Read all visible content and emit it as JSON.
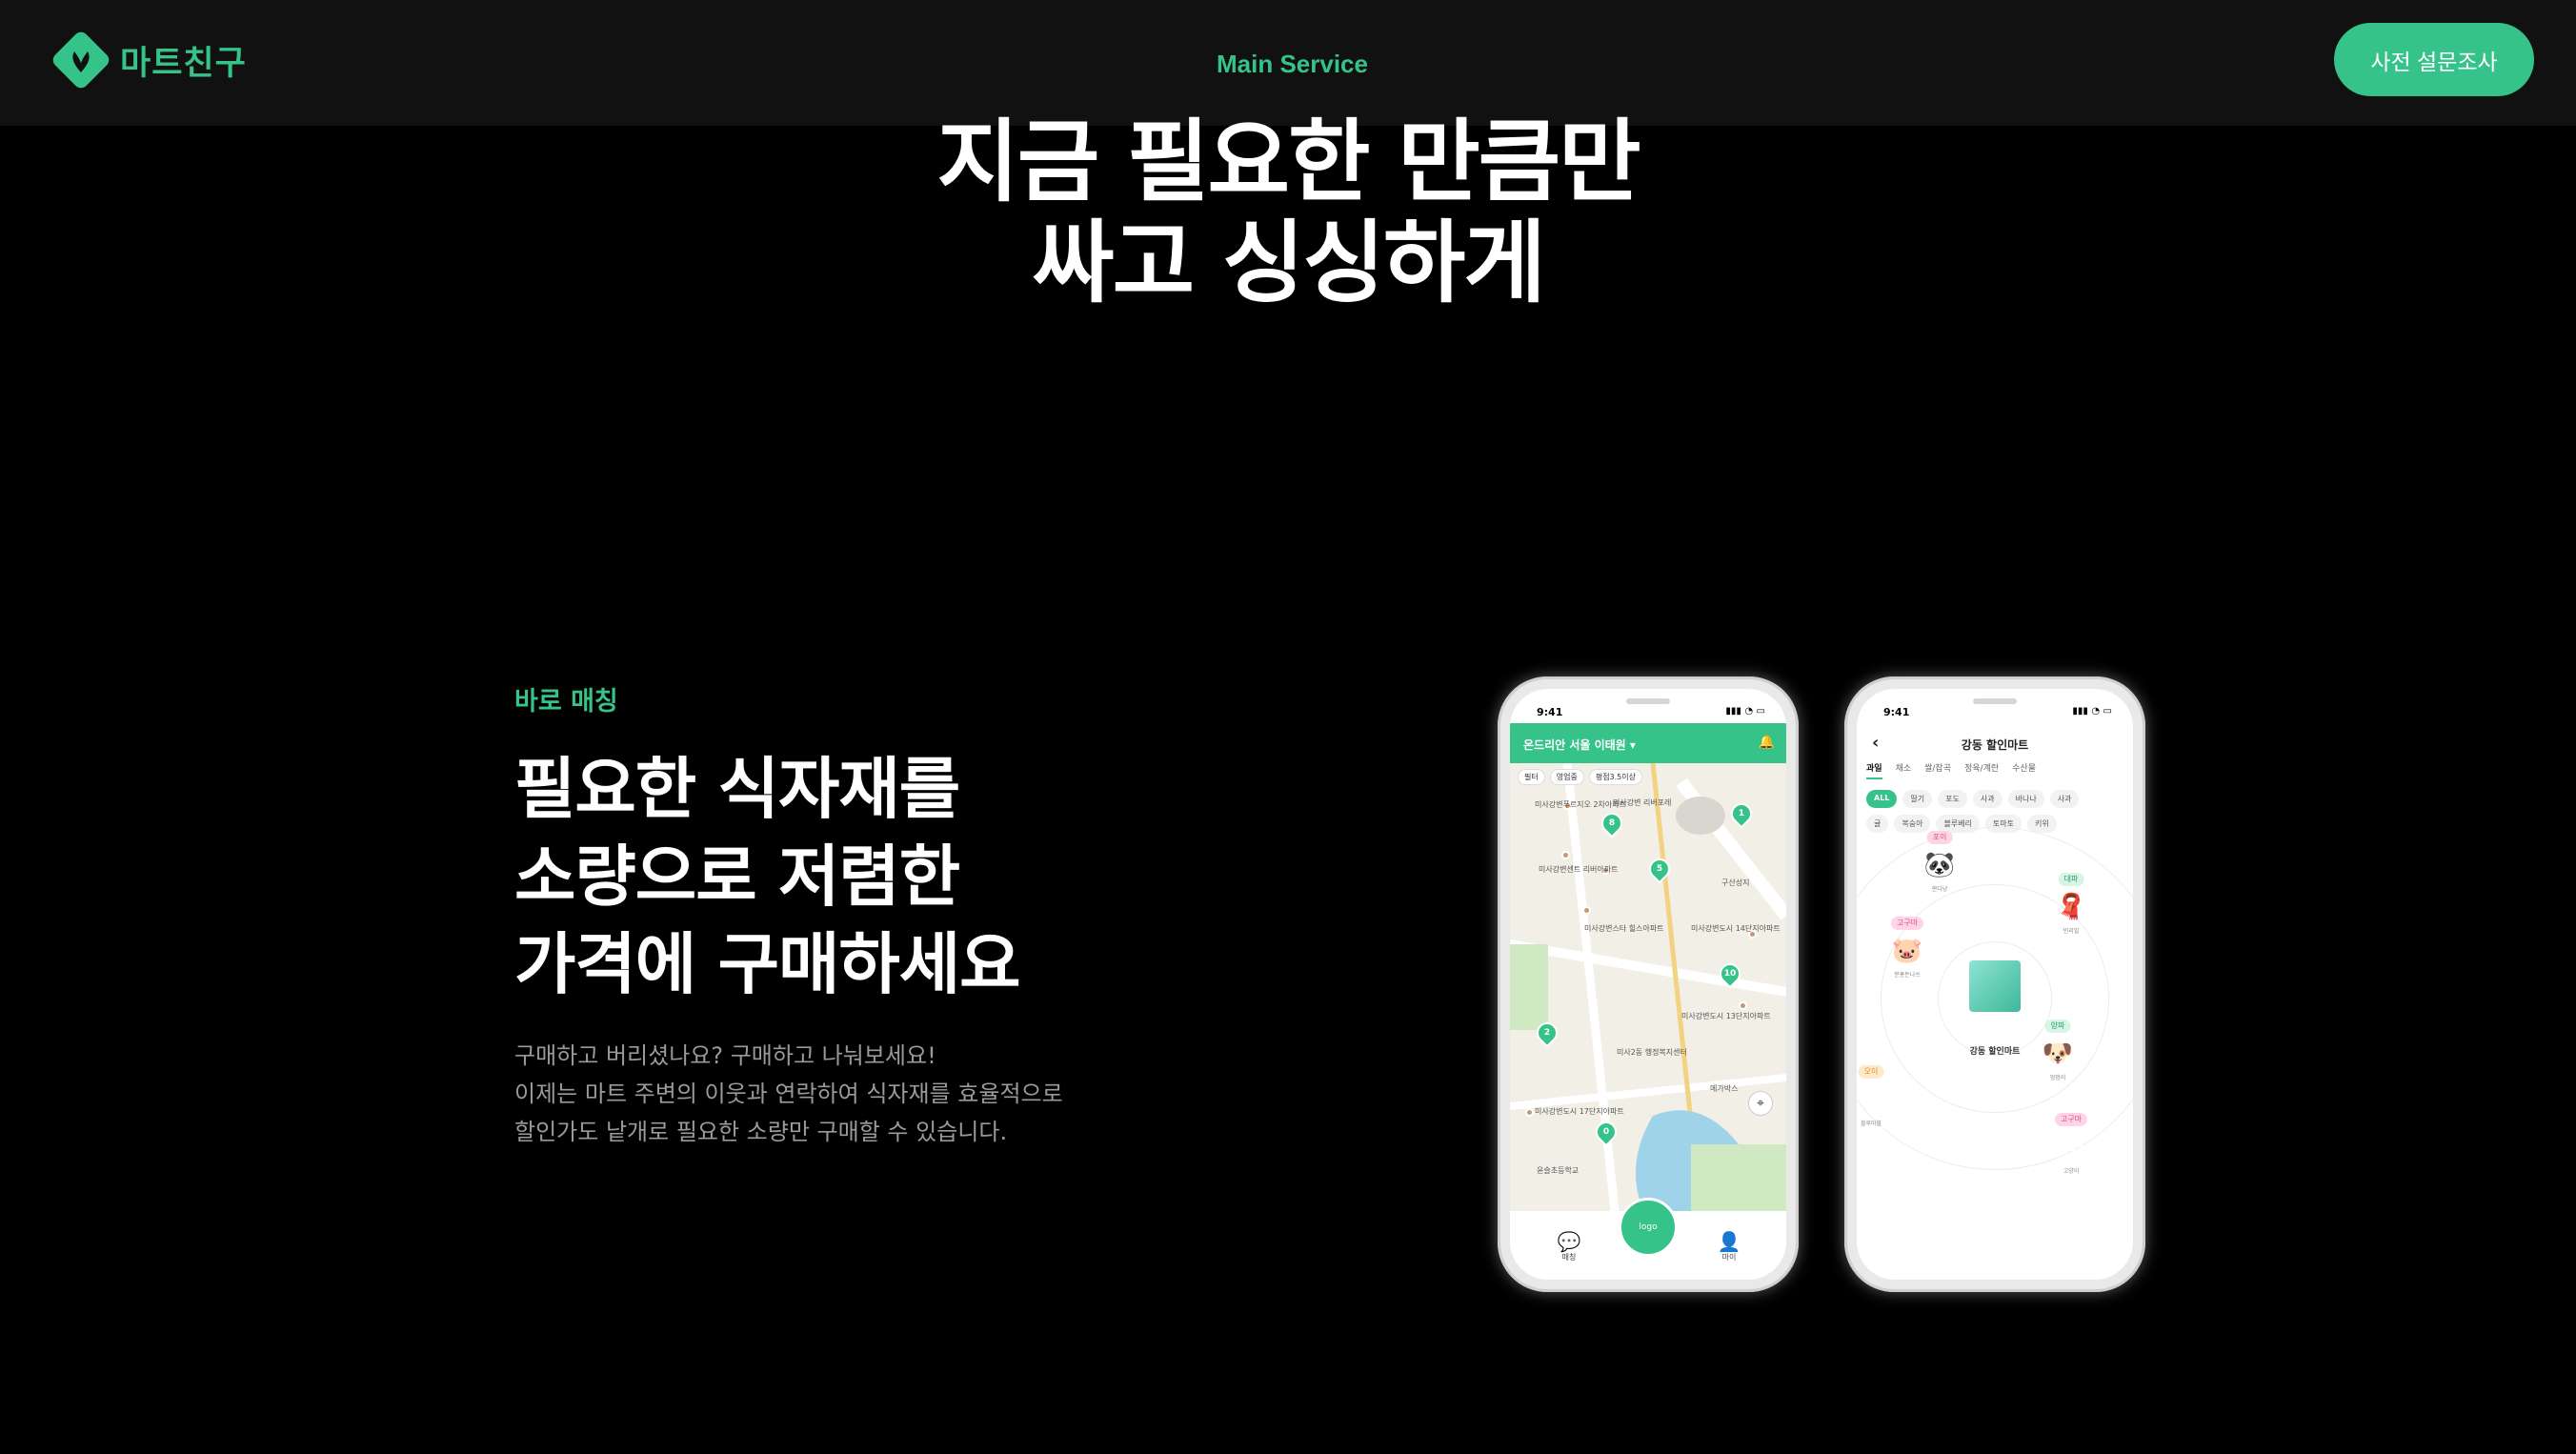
{
  "nav": {
    "logo_text": "마트친구",
    "main_link": "Main Service",
    "cta_button": "사전 설문조사",
    "accent_color": "#36c389"
  },
  "hero": {
    "line1": "지금 필요한 만큼만",
    "line2": "싸고 싱싱하게"
  },
  "feature": {
    "eyebrow": "바로 매칭",
    "title_lines": [
      "필요한 식자재를",
      "소량으로 저렴한",
      "가격에 구매하세요"
    ],
    "desc_lines": [
      "구매하고 버리셨나요? 구매하고 나눠보세요!",
      "이제는 마트 주변의 이웃과 연락하여 식자재를 효율적으로",
      "할인가도 낱개로 필요한 소량만 구매할 수 있습니다."
    ]
  },
  "phone_map": {
    "time": "9:41",
    "location": "온드리안 서울 이태원 ▾",
    "chips": [
      "필터",
      "영업중",
      "평점3.5이상"
    ],
    "pins": [
      "8",
      "5",
      "1",
      "10",
      "2",
      "0"
    ],
    "pois": [
      "미사강변푸르지오 2차아파트",
      "미사강변 리버포레",
      "미사강변센트 리버아파트",
      "미사강변스타 힐스아파트",
      "미사강변도시 14단지아파트",
      "미사강변도시 13단지아파트",
      "미사2동 행정복지센터",
      "메가박스",
      "미사강변도시 17단지아파트",
      "윤슬초등학교",
      "구산성지"
    ],
    "tabs": [
      "매칭",
      "마이"
    ],
    "fab_label": "logo"
  },
  "phone_store": {
    "time": "9:41",
    "title": "강동 할인마트",
    "category_tabs": [
      "과일",
      "채소",
      "쌀/잡곡",
      "정육/계란",
      "수산물"
    ],
    "filter_row1": [
      "ALL",
      "딸기",
      "포도",
      "사과",
      "바나나",
      "사과"
    ],
    "filter_row2": [
      "귤",
      "복숭아",
      "블루베리",
      "토마토",
      "키위"
    ],
    "store_label": "강동 할인마트",
    "avatars": [
      {
        "tag": "포이",
        "nick": "판다냥"
      },
      {
        "tag": "대파",
        "nick": "빈리빌"
      },
      {
        "tag": "고구마",
        "nick": "분홍돈나쓰"
      },
      {
        "tag": "양파",
        "nick": "멍멍이"
      },
      {
        "tag": "오이",
        "nick": "블루마블"
      },
      {
        "tag": "고구마",
        "nick": "고양이"
      }
    ]
  }
}
